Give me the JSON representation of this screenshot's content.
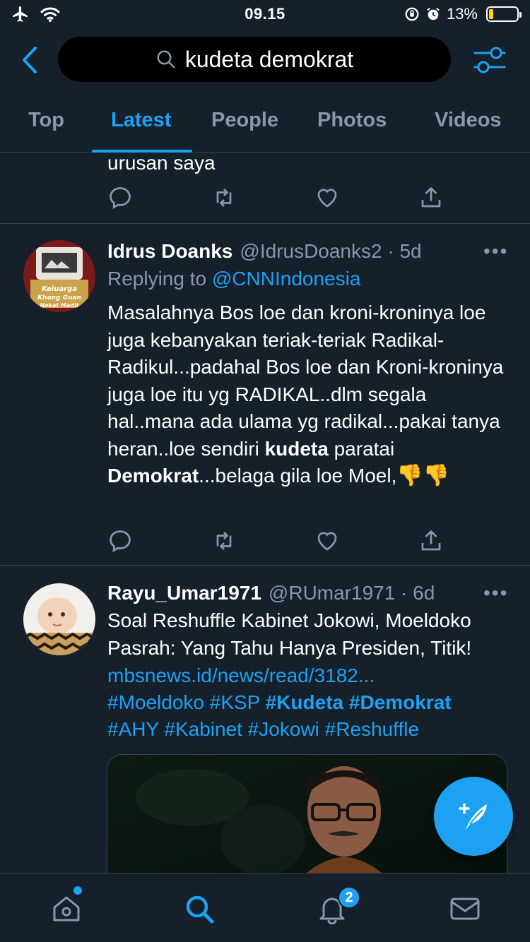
{
  "status": {
    "time": "09.15",
    "battery": "13%"
  },
  "search": {
    "query": "kudeta demokrat"
  },
  "tabs": [
    {
      "label": "Top"
    },
    {
      "label": "Latest"
    },
    {
      "label": "People"
    },
    {
      "label": "Photos"
    },
    {
      "label": "Videos"
    }
  ],
  "tweets": [
    {
      "text_tail": "urusan saya"
    },
    {
      "name": "Idrus Doanks",
      "handle": "@IdrusDoanks2 · 5d",
      "reply_prefix": "Replying to ",
      "reply_to": "@CNNIndonesia",
      "text_part1": "Masalahnya Bos loe dan kroni-kroninya loe juga kebanyakan teriak-teriak Radikal-Radikul...padahal Bos loe dan Kroni-kroninya juga loe  itu yg RADIKAL..dlm segala hal..mana ada ulama yg radikal...pakai tanya heran..loe sendiri ",
      "text_bold1": "kudeta",
      "text_part2": " paratai ",
      "text_bold2": "Demokrat",
      "text_part3": "...belaga gila loe Moel,",
      "emoji": "👎👎",
      "avatar_text": "Keluarga Khong Guan Nekat Madit"
    },
    {
      "name": "Rayu_Umar1971",
      "handle": "@RUmar1971 · 6d",
      "text": "Soal Reshuffle Kabinet Jokowi, Moeldoko Pasrah: Yang Tahu Hanya Presiden, Titik!",
      "url": "mbsnews.id/news/read/3182...",
      "hashtags_line1_a": "#Moeldoko #KSP ",
      "hashtags_line1_b": "#Kudeta #Demokrat",
      "hashtags_line2": "#AHY #Kabinet #Jokowi #Reshuffle"
    }
  ],
  "bottom_nav": {
    "notifications_badge": "2"
  },
  "colors": {
    "background": "#15202b",
    "accent": "#1da1f2",
    "muted": "#8899a6",
    "divider": "#38444d"
  }
}
